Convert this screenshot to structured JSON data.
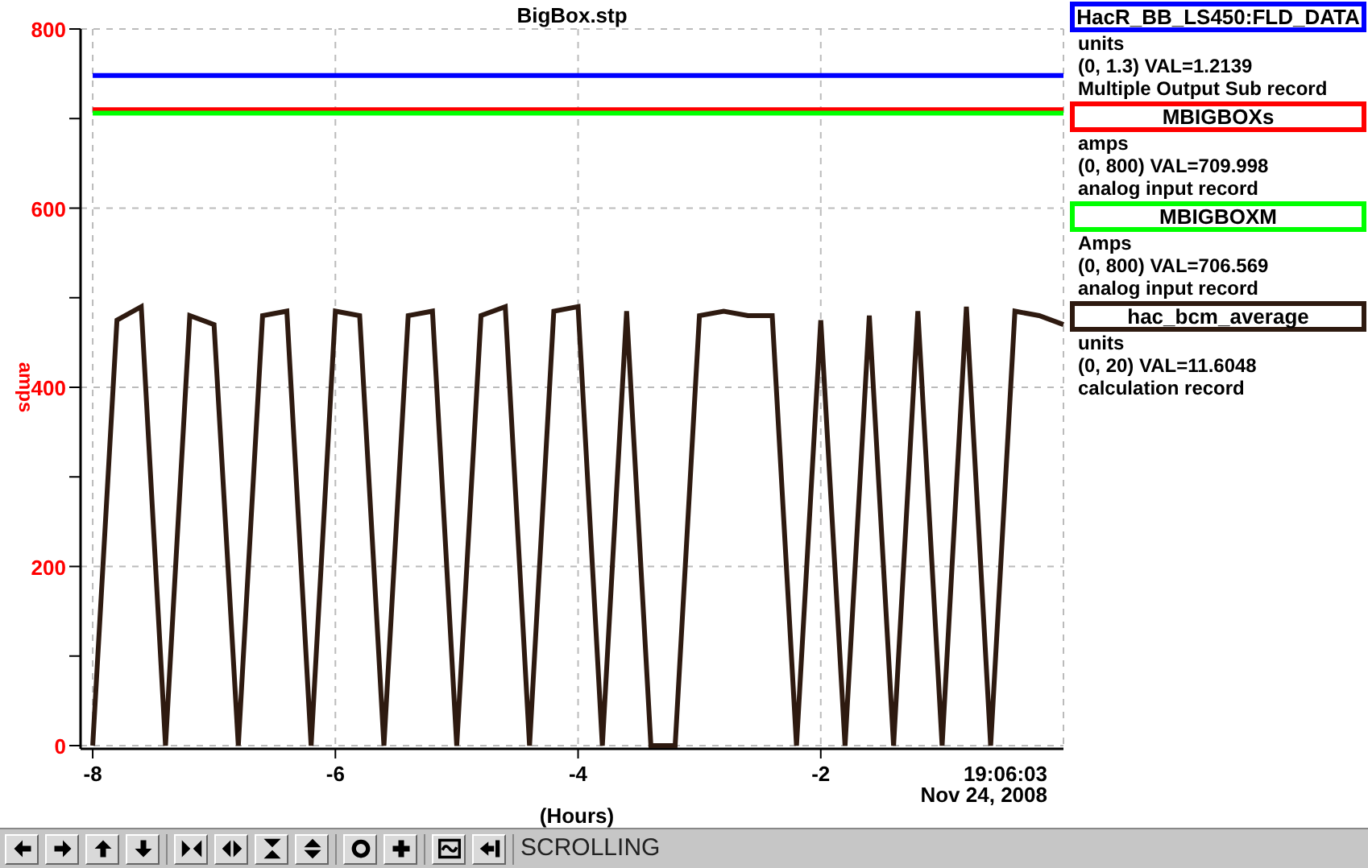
{
  "chart": {
    "chart_data": {
      "type": "line",
      "title": "BigBox.stp",
      "xlabel": "(Hours)",
      "ylabel": "amps",
      "xlim": [
        -8.1,
        0
      ],
      "ylim": [
        0,
        800
      ],
      "xticks": [
        -8,
        -6,
        -4,
        -2
      ],
      "yticks": [
        0,
        200,
        400,
        600,
        800
      ],
      "grid": true,
      "x": [
        -8,
        -7.8,
        -7.6,
        -7.4,
        -7.2,
        -7,
        -6.8,
        -6.6,
        -6.4,
        -6.2,
        -6,
        -5.8,
        -5.6,
        -5.4,
        -5.2,
        -5,
        -4.8,
        -4.6,
        -4.4,
        -4.2,
        -4,
        -3.8,
        -3.6,
        -3.4,
        -3.2,
        -3,
        -2.8,
        -2.6,
        -2.4,
        -2.2,
        -2,
        -1.8,
        -1.6,
        -1.4,
        -1.2,
        -1,
        -0.8,
        -0.6,
        -0.4,
        -0.2,
        0
      ],
      "series": [
        {
          "name": "HacR_BB_LS450:FLD_DATA",
          "color": "#0000ff",
          "values": [
            748,
            748,
            748,
            748,
            748,
            748,
            748,
            748,
            748,
            748,
            748,
            748,
            748,
            748,
            748,
            748,
            748,
            748,
            748,
            748,
            748,
            748,
            748,
            748,
            748,
            748,
            748,
            748,
            748,
            748,
            748,
            748,
            748,
            748,
            748,
            748,
            748,
            748,
            748,
            748,
            748
          ]
        },
        {
          "name": "MBIGBOXs",
          "color": "#ff0000",
          "values": [
            710,
            710,
            710,
            710,
            710,
            710,
            710,
            710,
            710,
            710,
            710,
            710,
            710,
            710,
            710,
            710,
            710,
            710,
            710,
            710,
            710,
            710,
            710,
            710,
            710,
            710,
            710,
            710,
            710,
            710,
            710,
            710,
            710,
            710,
            710,
            710,
            710,
            710,
            710,
            710,
            710
          ]
        },
        {
          "name": "MBIGBOXM",
          "color": "#00ff00",
          "values": [
            706,
            706,
            706,
            706,
            706,
            706,
            706,
            706,
            706,
            706,
            706,
            706,
            706,
            706,
            706,
            706,
            706,
            706,
            706,
            706,
            706,
            706,
            706,
            706,
            706,
            706,
            706,
            706,
            706,
            706,
            706,
            706,
            706,
            706,
            706,
            706,
            706,
            706,
            706,
            706,
            706
          ]
        },
        {
          "name": "hac_bcm_average",
          "color": "#2e1a10",
          "values": [
            0,
            475,
            490,
            0,
            480,
            470,
            0,
            480,
            485,
            0,
            485,
            480,
            0,
            480,
            485,
            0,
            480,
            490,
            0,
            485,
            490,
            0,
            485,
            0,
            0,
            480,
            485,
            480,
            480,
            0,
            475,
            0,
            480,
            0,
            485,
            0,
            490,
            0,
            485,
            480,
            470
          ]
        }
      ]
    },
    "time_label": "19:06:03",
    "date_label": "Nov 24, 2008"
  },
  "legend": [
    {
      "units": "units",
      "reading": "(0, 1.3) VAL=1.2139",
      "record_type": "Multiple Output Sub record"
    },
    {
      "units": "amps",
      "reading": "(0, 800) VAL=709.998",
      "record_type": "analog input record"
    },
    {
      "units": "Amps",
      "reading": "(0, 800) VAL=706.569",
      "record_type": "analog input record"
    },
    {
      "units": "units",
      "reading": "(0, 20) VAL=11.6048",
      "record_type": "calculation record"
    }
  ],
  "toolbar": {
    "groups": [
      [
        {
          "kind": "left"
        },
        {
          "kind": "right"
        },
        {
          "kind": "up"
        },
        {
          "kind": "down"
        }
      ],
      [
        {
          "kind": "zoom-in-x"
        },
        {
          "kind": "zoom-out-x"
        },
        {
          "kind": "zoom-in-y"
        },
        {
          "kind": "zoom-out-y"
        }
      ],
      [
        {
          "kind": "circle"
        },
        {
          "kind": "plus"
        }
      ],
      [
        {
          "kind": "wave"
        },
        {
          "kind": "back"
        }
      ]
    ],
    "status": "SCROLLING"
  }
}
